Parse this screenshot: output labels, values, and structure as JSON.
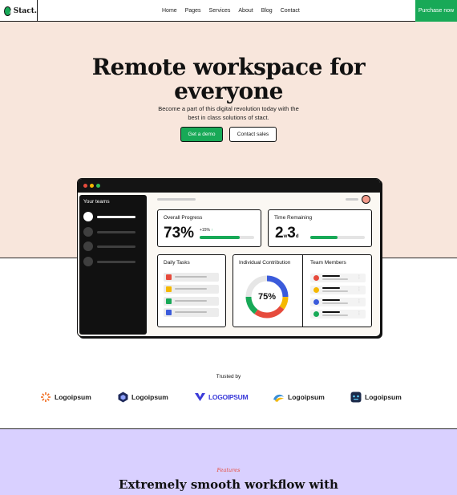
{
  "nav": {
    "brand": "Stact.",
    "links": [
      "Home",
      "Pages",
      "Services",
      "About",
      "Blog",
      "Contact"
    ],
    "cta": "Purchase now"
  },
  "hero": {
    "title_line1": "Remote workspace for",
    "title_line2": "everyone",
    "subtitle": "Become a part of this digital revolution today with the best in class solutions of stact.",
    "primary_button": "Get a demo",
    "secondary_button": "Contact sales"
  },
  "dashboard": {
    "sidebar_title": "Your teams",
    "overall_progress": {
      "label": "Overall Progress",
      "value": "73%",
      "change": "+15%",
      "progress": 0.73
    },
    "time_remaining": {
      "label": "Time Remaining",
      "weeks": "2",
      "weeks_unit": "w",
      "days": "3",
      "days_unit": "d",
      "progress": 0.5
    },
    "daily_tasks": {
      "label": "Daily Tasks",
      "task_colors": [
        "#e64b3c",
        "#f5b800",
        "#18a957",
        "#3b5bdb"
      ]
    },
    "individual_contribution": {
      "label": "Individual Contribution",
      "value": "75%",
      "segments": [
        {
          "color": "#3b5bdb",
          "share": 0.25
        },
        {
          "color": "#f5b800",
          "share": 0.1
        },
        {
          "color": "#e64b3c",
          "share": 0.25
        },
        {
          "color": "#18a957",
          "share": 0.15
        },
        {
          "color": "#e6e6e6",
          "share": 0.25
        }
      ]
    },
    "team_members": {
      "label": "Team Members",
      "member_colors": [
        "#e64b3c",
        "#f5b800",
        "#3b5bdb",
        "#18a957"
      ]
    }
  },
  "trusted": {
    "heading": "Trusted by",
    "logos": [
      "Logoipsum",
      "Logoipsum",
      "LOGOIPSUM",
      "Logoipsum",
      "Logoipsum"
    ]
  },
  "features": {
    "kicker": "Features",
    "title": "Extremely smooth workflow with"
  },
  "colors": {
    "accent": "#18a957",
    "hero_bg": "#f8e6dc",
    "features_bg": "#d9d0ff"
  }
}
